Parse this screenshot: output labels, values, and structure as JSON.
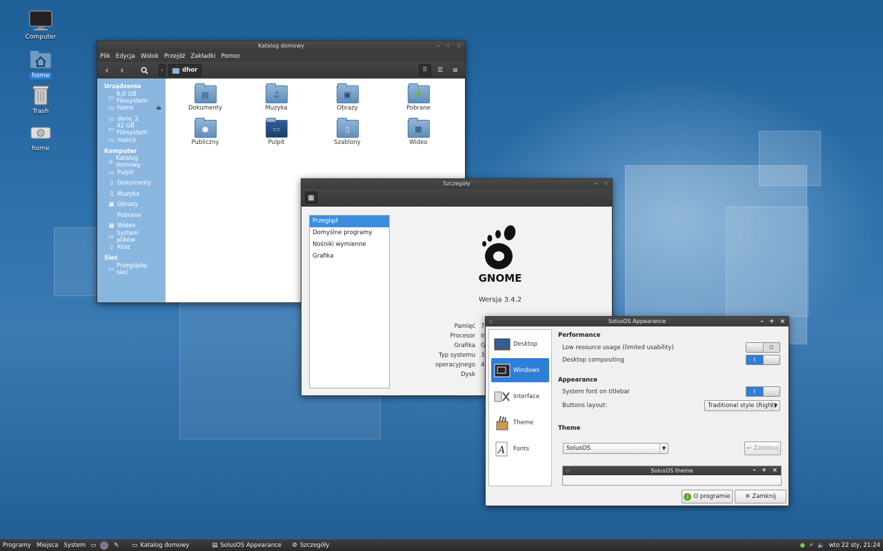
{
  "desktop": {
    "icons": [
      {
        "label": "Computer",
        "icon": "monitor-icon"
      },
      {
        "label": "home",
        "icon": "home-folder-icon"
      },
      {
        "label": "Trash",
        "icon": "trash-icon"
      },
      {
        "label": "home",
        "icon": "drive-icon"
      }
    ]
  },
  "file_manager": {
    "title": "Katalog domowy",
    "menu": [
      "Plik",
      "Edycja",
      "Widok",
      "Przejdź",
      "Zakładki",
      "Pomoc"
    ],
    "path": "dhor",
    "sidebar": {
      "devices_header": "Urządzenia",
      "devices": [
        "6,0 GB Filesystem",
        "home",
        "dane_2",
        "42 GB Filesystem",
        "main3"
      ],
      "computer_header": "Komputer",
      "computer": [
        "Katalog domowy",
        "Pulpit",
        "Dokumenty",
        "Muzyka",
        "Obrazy",
        "Pobrane",
        "Wideo",
        "System plików",
        "Kosz"
      ],
      "network_header": "Sieć",
      "network": [
        "Przeglądaj sieć"
      ]
    },
    "files": [
      {
        "name": "Dokumenty",
        "icon": "document-folder-icon"
      },
      {
        "name": "Muzyka",
        "icon": "music-folder-icon"
      },
      {
        "name": "Obrazy",
        "icon": "pictures-folder-icon"
      },
      {
        "name": "Pobrane",
        "icon": "download-folder-icon"
      },
      {
        "name": "Publiczny",
        "icon": "public-folder-icon"
      },
      {
        "name": "Pulpit",
        "icon": "desktop-folder-icon"
      },
      {
        "name": "Szablony",
        "icon": "templates-folder-icon"
      },
      {
        "name": "Wideo",
        "icon": "video-folder-icon"
      }
    ]
  },
  "details": {
    "title": "Szczegóły",
    "nav": [
      "Przegląd",
      "Domyślne programy",
      "Nośniki wymienne",
      "Grafika"
    ],
    "logo_text": "GNOME",
    "version": "Wersja 3.4.2",
    "labels": [
      "Pamięć",
      "Procesor",
      "Grafika",
      "Typ systemu operacyjnego",
      "Dysk"
    ],
    "values": [
      "7",
      "In",
      "G",
      "32",
      "4"
    ]
  },
  "appearance": {
    "title": "SolusOS Appearance",
    "nav": [
      "Desktop",
      "Windows",
      "Interface",
      "Theme",
      "Fonts"
    ],
    "perf_header": "Performance",
    "low_resource": "Low resource usage (limited usability)",
    "compositing": "Desktop compositing",
    "app_header": "Appearance",
    "system_font": "System font on titlebar",
    "buttons_layout": "Buttons layout:",
    "buttons_layout_value": "Traditional style (Right)",
    "theme_header": "Theme",
    "theme_value": "SolusOS",
    "apply": "Zastosuj",
    "preview_title": "SolusOS theme",
    "about": "O programie",
    "close": "Zamknij",
    "switch_on": "I",
    "switch_off": "O"
  },
  "taskbar": {
    "menus": [
      "Programy",
      "Miejsca",
      "System"
    ],
    "tasks": [
      "Katalog domowy",
      "SolusOS Appearance",
      "Szczegóły"
    ],
    "clock": "wto 22 sty, 21:24"
  }
}
